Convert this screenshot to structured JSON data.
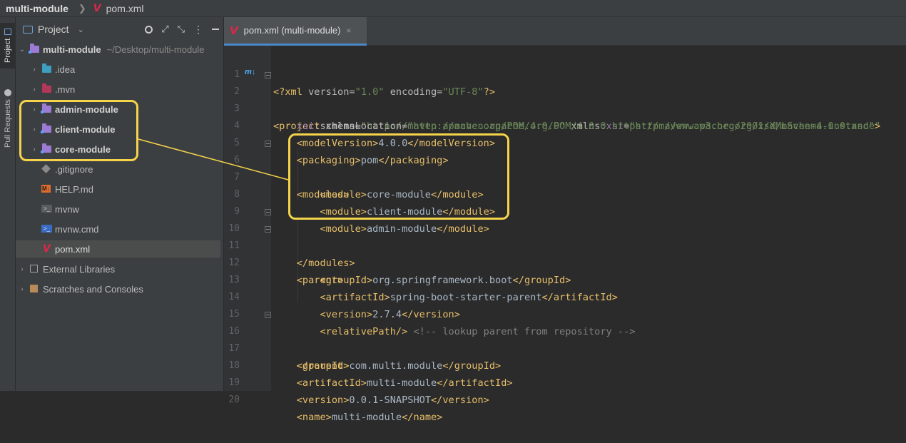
{
  "breadcrumb": {
    "project": "multi-module",
    "file": "pom.xml",
    "logo": "V"
  },
  "side_tabs": {
    "project": "Project",
    "pull_requests": "Pull Requests"
  },
  "project_panel": {
    "title": "Project",
    "tools": [
      "target-icon",
      "expand-icon",
      "collapse-icon",
      "more-icon",
      "minimize-icon"
    ],
    "tree": [
      {
        "label": "multi-module",
        "path": "~/Desktop/multi-module",
        "icon": "folder-module-icon",
        "expanded": true
      },
      {
        "label": ".idea",
        "icon": "folder-icon"
      },
      {
        "label": ".mvn",
        "icon": "folder-icon"
      },
      {
        "label": "admin-module",
        "icon": "folder-module-icon"
      },
      {
        "label": "client-module",
        "icon": "folder-module-icon"
      },
      {
        "label": "core-module",
        "icon": "folder-module-icon"
      },
      {
        "label": ".gitignore",
        "icon": "git-icon"
      },
      {
        "label": "HELP.md",
        "icon": "markdown-icon",
        "icon_text": "M↓"
      },
      {
        "label": "mvnw",
        "icon": "terminal-icon",
        "icon_text": ">_"
      },
      {
        "label": "mvnw.cmd",
        "icon": "terminal-icon",
        "icon_text": ">_"
      },
      {
        "label": "pom.xml",
        "icon": "maven-icon",
        "selected": true
      },
      {
        "label": "External Libraries",
        "icon": "library-icon"
      },
      {
        "label": "Scratches and Consoles",
        "icon": "scratches-icon"
      }
    ]
  },
  "editor": {
    "tab_label": "pom.xml (multi-module)",
    "tab_close": "×",
    "gutter_marker": "m↓",
    "line_numbers": [
      "1",
      "2",
      "3",
      "4",
      "5",
      "6",
      "7",
      "8",
      "9",
      "10",
      "11",
      "12",
      "13",
      "14",
      "15",
      "16",
      "17",
      "18",
      "19",
      "20"
    ]
  },
  "colors": {
    "background": "#2b2b2b",
    "panel": "#3c3f41",
    "tag": "#e8bf6a",
    "attribute_value": "#6a8759",
    "comment": "#808080",
    "highlight": "#f5d34a",
    "maven_logo": "#e0254a"
  }
}
